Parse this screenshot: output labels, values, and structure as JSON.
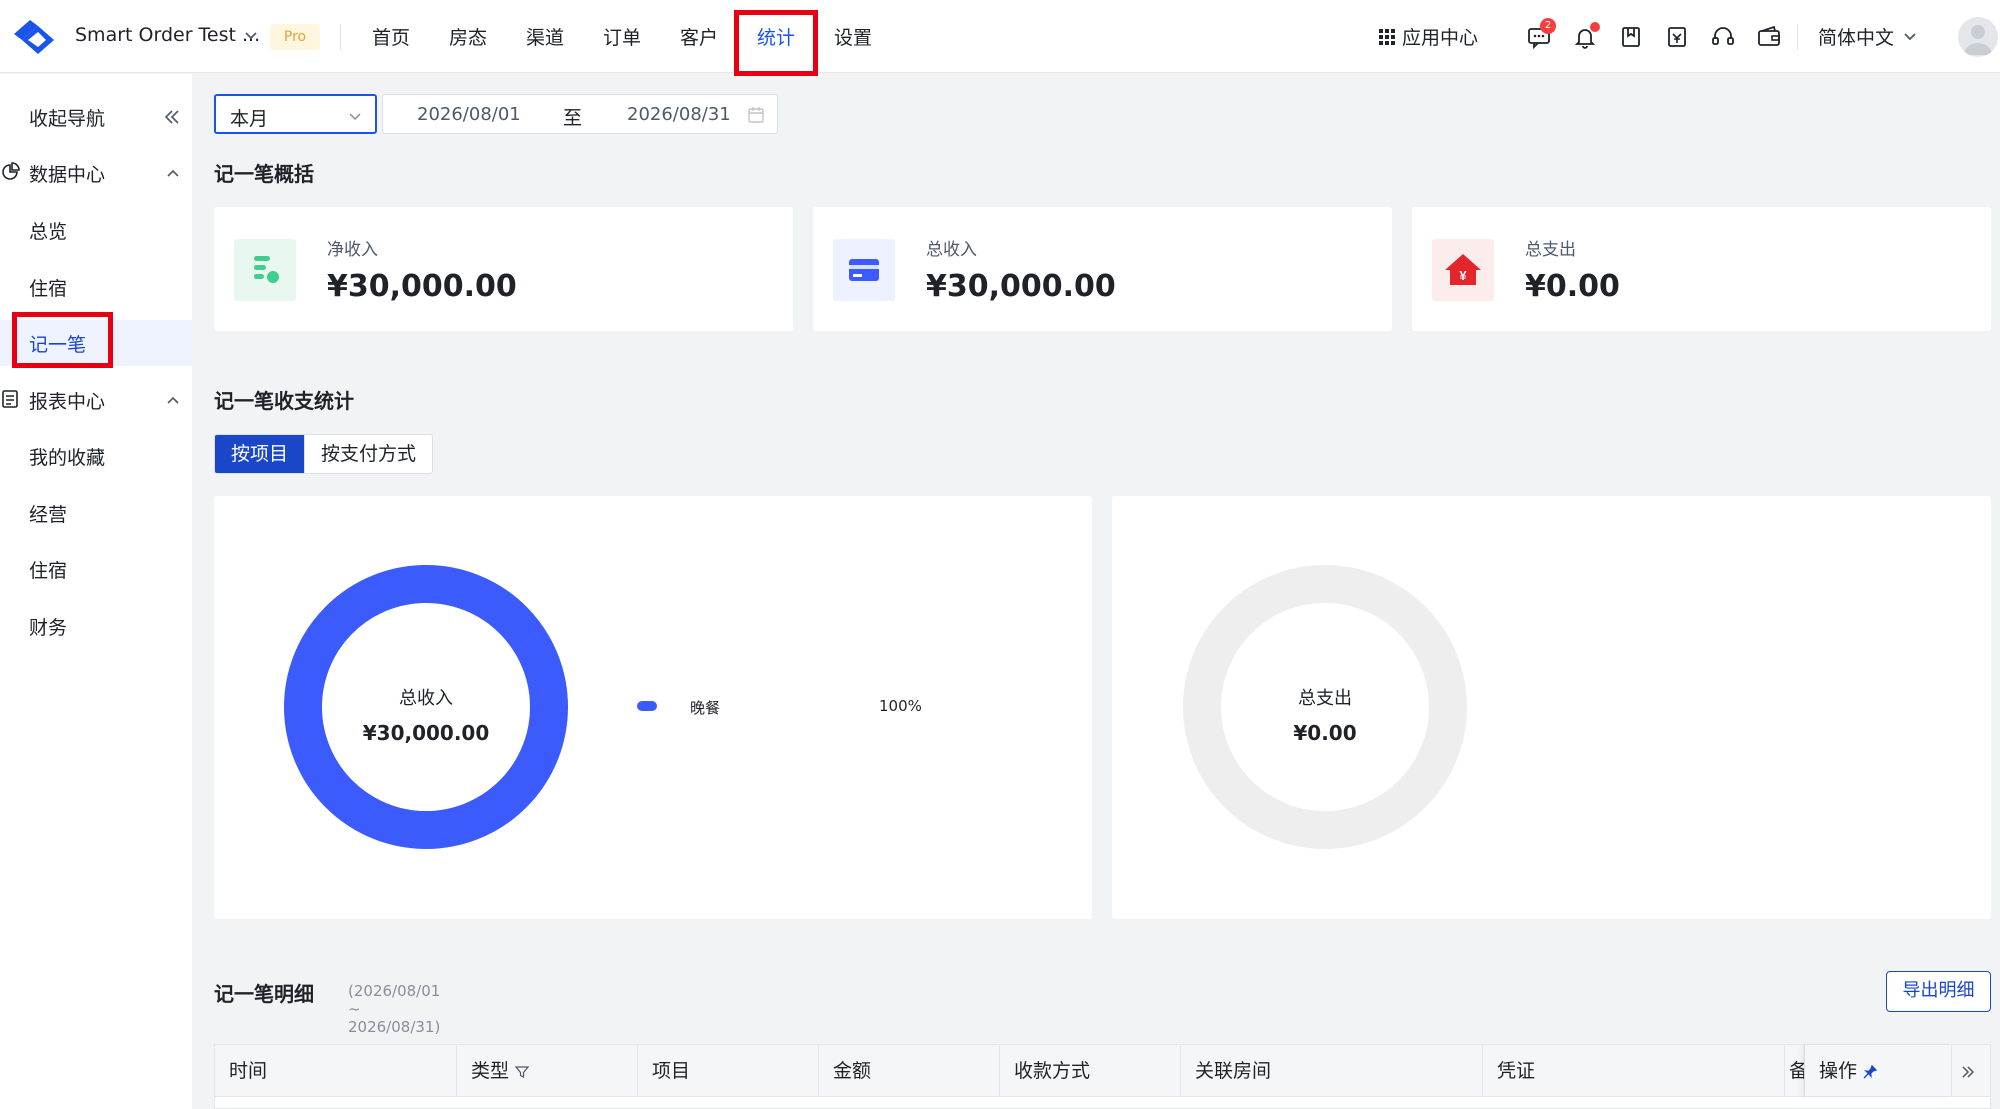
{
  "header": {
    "org_name": "Smart Order Test ...",
    "plan_badge": "Pro",
    "nav": [
      "首页",
      "房态",
      "渠道",
      "订单",
      "客户",
      "统计",
      "设置"
    ],
    "active_nav": "统计",
    "app_center": "应用中心",
    "message_count": "2",
    "language": "简体中文"
  },
  "sidebar": {
    "collapse_label": "收起导航",
    "data_center": "数据中心",
    "overview": "总览",
    "lodging": "住宿",
    "ledger": "记一笔",
    "report_center": "报表中心",
    "favorites": "我的收藏",
    "operations": "经营",
    "lodging_report": "住宿",
    "finance": "财务"
  },
  "filters": {
    "range_option": "本月",
    "start_date": "2026/08/01",
    "to_label": "至",
    "end_date": "2026/08/31"
  },
  "overview": {
    "title": "记一笔概括",
    "cards": [
      {
        "label": "净收入",
        "value": "¥30,000.00",
        "color": "#3ecf8e"
      },
      {
        "label": "总收入",
        "value": "¥30,000.00",
        "color": "#3b5bfd"
      },
      {
        "label": "总支出",
        "value": "¥0.00",
        "color": "#e5242b"
      }
    ]
  },
  "stats": {
    "title": "记一笔收支统计",
    "tabs": [
      "按项目",
      "按支付方式"
    ],
    "active_tab": "按项目"
  },
  "chart_data": [
    {
      "type": "pie",
      "center_label": "总收入",
      "center_value": "¥30,000.00",
      "slices": [
        {
          "name": "晚餐",
          "value": 100,
          "label": "100%",
          "color": "#3b5bfd"
        }
      ]
    },
    {
      "type": "pie",
      "center_label": "总支出",
      "center_value": "¥0.00",
      "slices": []
    }
  ],
  "detail": {
    "title": "记一笔明细",
    "range": "(2026/08/01 ~ 2026/08/31)",
    "export_label": "导出明细",
    "columns": [
      "时间",
      "类型",
      "项目",
      "金额",
      "收款方式",
      "关联房间",
      "凭证",
      "备",
      "操作"
    ]
  }
}
